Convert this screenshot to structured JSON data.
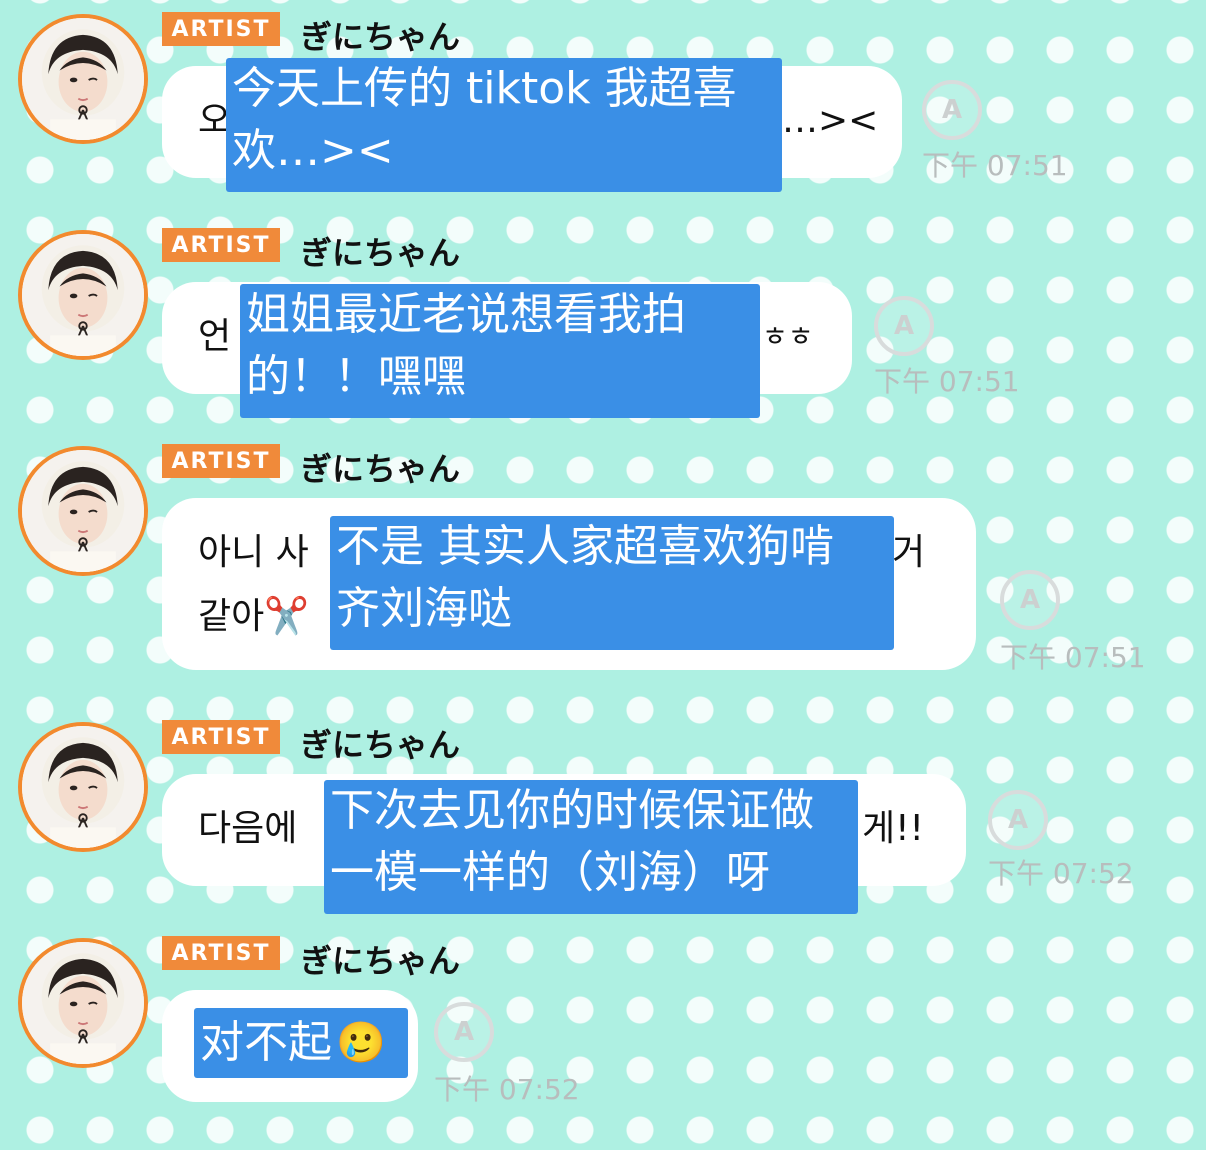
{
  "messages": [
    {
      "badge": "ARTIST",
      "sender": "ぎにちゃん",
      "original": "오…><",
      "translation_line1": "今天上传的 tiktok 我超喜",
      "translation_line2": "欢…><",
      "read_icon": "A",
      "time": "下午 07:51"
    },
    {
      "badge": "ARTIST",
      "sender": "ぎにちゃん",
      "original": "언ㅎㅎ",
      "translation_line1": "姐姐最近老说想看我拍",
      "translation_line2": "的！！嘿嘿",
      "read_icon": "A",
      "time": "下午 07:51"
    },
    {
      "badge": "ARTIST",
      "sender": "ぎにちゃん",
      "original_line1": "아니 사거",
      "original_line2": "같아✂️",
      "translation_line1": "不是 其实人家超喜欢狗啃",
      "translation_line2": "齐刘海哒",
      "read_icon": "A",
      "time": "下午 07:51"
    },
    {
      "badge": "ARTIST",
      "sender": "ぎにちゃん",
      "original_left": "다음에",
      "original_right": "게!!",
      "translation_line1": "下次去见你的时候保证做",
      "translation_line2": "一模一样的（刘海）呀",
      "read_icon": "A",
      "time": "下午 07:52"
    },
    {
      "badge": "ARTIST",
      "sender": "ぎにちゃん",
      "translation_line1": "对不起",
      "emoji": "🥲",
      "read_icon": "A",
      "time": "下午 07:52"
    }
  ]
}
